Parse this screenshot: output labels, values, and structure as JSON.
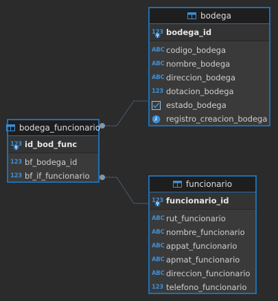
{
  "tables": {
    "bodega": {
      "title": "bodega",
      "pk": {
        "type": "123",
        "name": "bodega_id"
      },
      "columns": [
        {
          "type": "ABC",
          "name": "codigo_bodega"
        },
        {
          "type": "ABC",
          "name": "nombre_bodega"
        },
        {
          "type": "ABC",
          "name": "direccion_bodega"
        },
        {
          "type": "123",
          "name": "dotacion_bodega"
        },
        {
          "type": "checkbox",
          "name": "estado_bodega"
        },
        {
          "type": "clock",
          "name": "registro_creacion_bodega"
        }
      ]
    },
    "bodega_funcionario": {
      "title": "bodega_funcionario",
      "pk": {
        "type": "123",
        "name": "id_bod_func"
      },
      "columns": [
        {
          "type": "123",
          "name": "bf_bodega_id"
        },
        {
          "type": "123",
          "name": "bf_if_funcionario"
        }
      ]
    },
    "funcionario": {
      "title": "funcionario",
      "pk": {
        "type": "123",
        "name": "funcionario_id"
      },
      "columns": [
        {
          "type": "ABC",
          "name": "rut_funcionario"
        },
        {
          "type": "ABC",
          "name": "nombre_funcionario"
        },
        {
          "type": "ABC",
          "name": "appat_funcionario"
        },
        {
          "type": "ABC",
          "name": "apmat_funcionario"
        },
        {
          "type": "ABC",
          "name": "direccion_funcionario"
        },
        {
          "type": "123",
          "name": "telefono_funcionario"
        }
      ]
    }
  },
  "colors": {
    "background": "#2b2b2b",
    "border": "#1f6fb3",
    "type_icon": "#3d8fd6",
    "connector": "#6a8fb0"
  }
}
